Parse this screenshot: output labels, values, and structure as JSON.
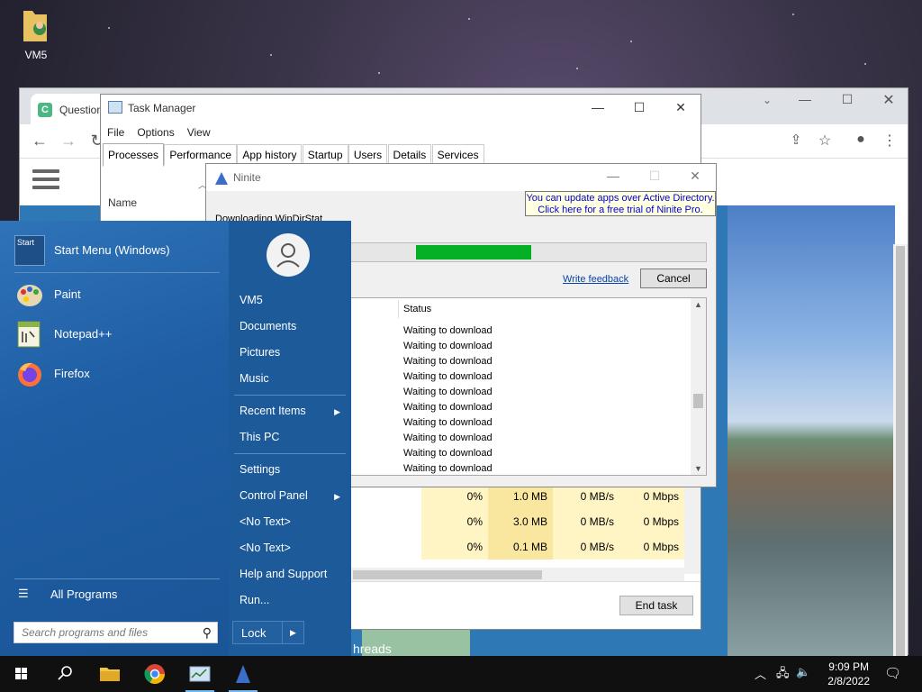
{
  "desktop": {
    "icon_label": "VM5"
  },
  "chrome": {
    "tab_title": "Question"
  },
  "taskmanager": {
    "title": "Task Manager",
    "menu": [
      "File",
      "Options",
      "View"
    ],
    "tabs": [
      "Processes",
      "Performance",
      "App history",
      "Startup",
      "Users",
      "Details",
      "Services"
    ],
    "name_header": "Name",
    "rows": [
      {
        "cpu": "0%",
        "mem": "1.0 MB",
        "disk": "0 MB/s",
        "net": "0 Mbps"
      },
      {
        "cpu": "0%",
        "mem": "3.0 MB",
        "disk": "0 MB/s",
        "net": "0 Mbps"
      },
      {
        "cpu": "0%",
        "mem": "0.1 MB",
        "disk": "0 MB/s",
        "net": "0 Mbps"
      }
    ],
    "end_task": "End task"
  },
  "ninite": {
    "title": "Ninite",
    "promo_line1": "You can update apps over Active Directory.",
    "promo_line2": "Click here for a free trial of Ninite Pro.",
    "downloading": "Downloading WinDirStat",
    "progress": 0.34,
    "feedback": "Write feedback",
    "cancel": "Cancel",
    "status_header": "Status",
    "statuses": [
      "Waiting to download",
      "Waiting to download",
      "Waiting to download",
      "Waiting to download",
      "Waiting to download",
      "Waiting to download",
      "Waiting to download",
      "Waiting to download",
      "Waiting to download",
      "Waiting to download"
    ]
  },
  "startmenu": {
    "pinned": [
      "Start Menu (Windows)",
      "Paint",
      "Notepad++",
      "Firefox"
    ],
    "start_icon_text": "Start",
    "all_programs": "All Programs",
    "search_placeholder": "Search programs and files",
    "right": {
      "user": "VM5",
      "documents": "Documents",
      "pictures": "Pictures",
      "music": "Music",
      "recent": "Recent Items",
      "thispc": "This PC",
      "settings": "Settings",
      "control": "Control Panel",
      "notext1": "<No Text>",
      "notext2": "<No Text>",
      "help": "Help and Support",
      "run": "Run..."
    },
    "lock": "Lock"
  },
  "background_text": {
    "threads": "hreads"
  },
  "taskbar": {
    "time": "9:09 PM",
    "date": "2/8/2022"
  },
  "colors": {
    "accent": "#1f5ea0",
    "progress": "#06b025"
  }
}
